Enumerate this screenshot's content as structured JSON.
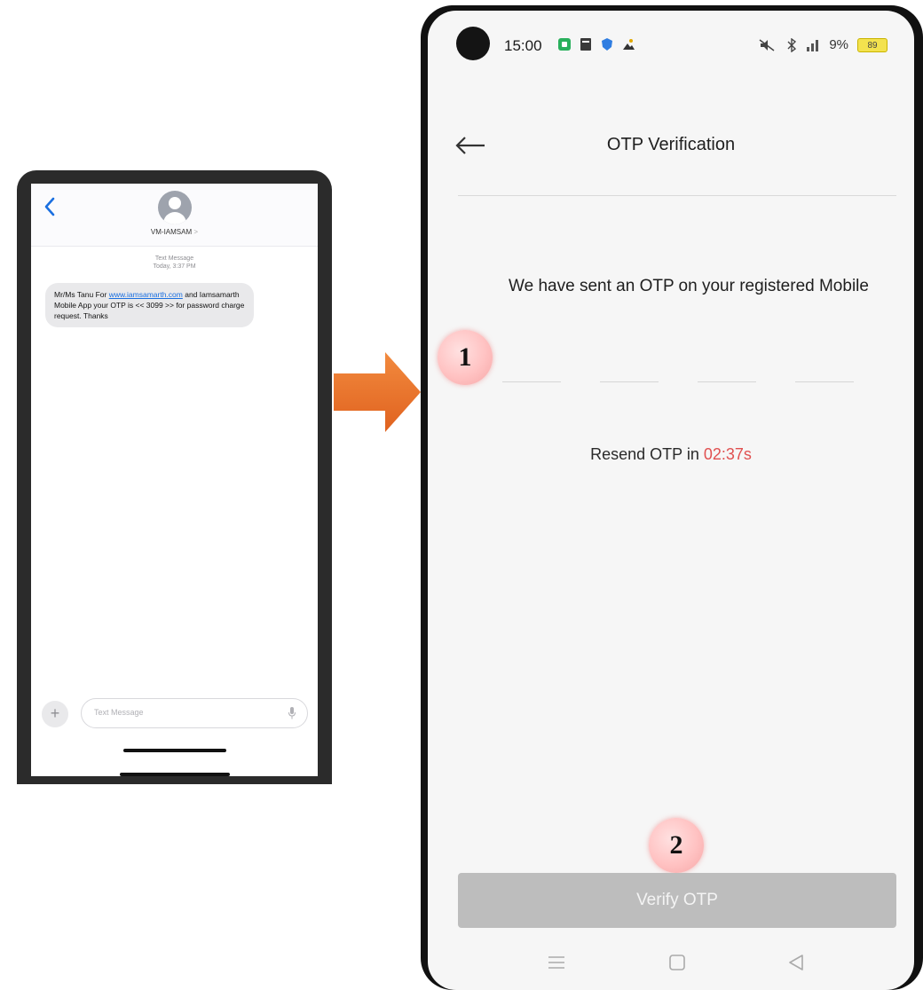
{
  "sms": {
    "contact": "VM-IAMSAM",
    "contact_chevron": ">",
    "message_type": "Text Message",
    "message_time": "Today, 3:37 PM",
    "message_prefix": "Mr/Ms Tanu For ",
    "message_link": "www.iamsamarth.com",
    "message_suffix": " and Iamsamarth Mobile App your OTP is << 3099 >> for password charge request. Thanks",
    "input_placeholder": "Text Message",
    "plus": "+"
  },
  "status_bar": {
    "time": "15:00",
    "battery_percent": "9%",
    "battery_label": "89"
  },
  "otp_screen": {
    "title": "OTP Verification",
    "sent_message": "We have sent an OTP on your registered Mobile",
    "otp_digits": [
      "",
      "",
      "",
      ""
    ],
    "resend_prefix": "Resend OTP in ",
    "resend_timer": "02:37s",
    "verify_label": "Verify OTP"
  },
  "callouts": {
    "one": "1",
    "two": "2"
  },
  "colors": {
    "arrow": "#e8702a",
    "timer": "#e05050",
    "verify_button": "#bdbdbd",
    "badge": "#ffc2c2",
    "link": "#1a6fe0"
  }
}
